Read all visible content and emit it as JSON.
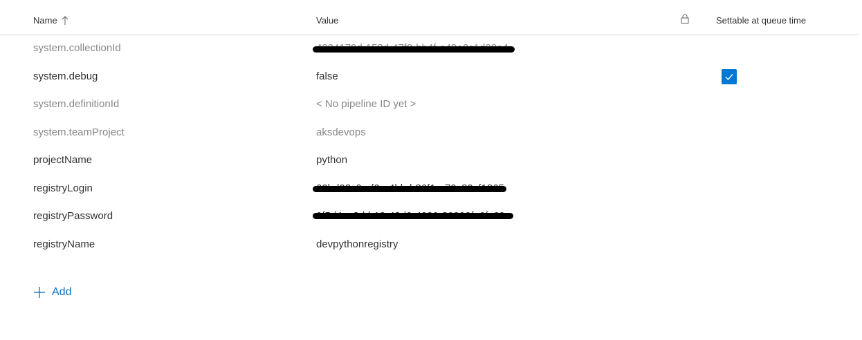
{
  "header": {
    "name_label": "Name",
    "value_label": "Value",
    "settable_label": "Settable at queue time",
    "sort_icon": "arrow-up-icon",
    "lock_icon": "lock-icon"
  },
  "rows": [
    {
      "name": "system.collectionId",
      "value": "4324179d-158d-47f8-bb4f-e49e2c1d38e4",
      "system": true,
      "redacted": true
    },
    {
      "name": "system.debug",
      "value": "false",
      "system": false,
      "settable": true
    },
    {
      "name": "system.definitionId",
      "value": "< No pipeline ID yet >",
      "system": true
    },
    {
      "name": "system.teamProject",
      "value": "aksdevops",
      "system": true
    },
    {
      "name": "projectName",
      "value": "python",
      "system": false
    },
    {
      "name": "registryLogin",
      "value": "60bd03c9-af0e-4bbd-86f1-a79c89cf1865",
      "system": false,
      "redacted": true
    },
    {
      "name": "registryPassword",
      "value": "0f5d4ce3-bb19-43d0-4090-30900fa0fc60",
      "system": false,
      "redacted": true
    },
    {
      "name": "registryName",
      "value": "devpythonregistry",
      "system": false
    }
  ],
  "add": {
    "label": "Add",
    "icon": "plus-icon"
  },
  "colors": {
    "accent": "#0078d4",
    "link": "#106ebe",
    "muted": "#8a8886",
    "text": "#323130"
  }
}
